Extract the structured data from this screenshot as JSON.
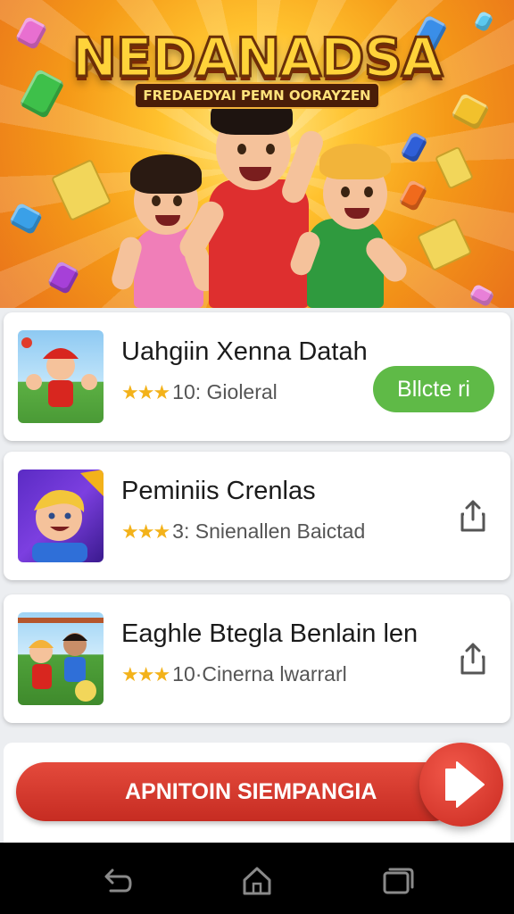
{
  "hero": {
    "title": "NEDANADSA",
    "subtitle": "FREDAEDYAI PEMN OORAYZEN"
  },
  "games": [
    {
      "title": "Uahgiin Xenna Datah",
      "rating_icon": "three-stars",
      "meta": "10: Gioleral",
      "action": "Bllcte ri"
    },
    {
      "title": "Peminiis Crenlas",
      "rating_icon": "three-stars",
      "meta": "3: Snienallen Baictad",
      "action_icon": "share-icon"
    },
    {
      "title": "Eaghle Btegla Benlain len",
      "rating_icon": "three-stars",
      "meta": "10·Cinerna lwarrarl",
      "action_icon": "share-icon"
    }
  ],
  "cta": {
    "label": "APNITOIN SIEMPANGIA",
    "icon": "play-icon"
  },
  "navbar": {
    "icons": [
      "back-icon",
      "home-icon",
      "recents-icon"
    ]
  },
  "colors": {
    "install_green": "#5fba47",
    "cta_red": "#d5352a",
    "star_gold": "#f3b21a",
    "nav_black": "#000000"
  }
}
